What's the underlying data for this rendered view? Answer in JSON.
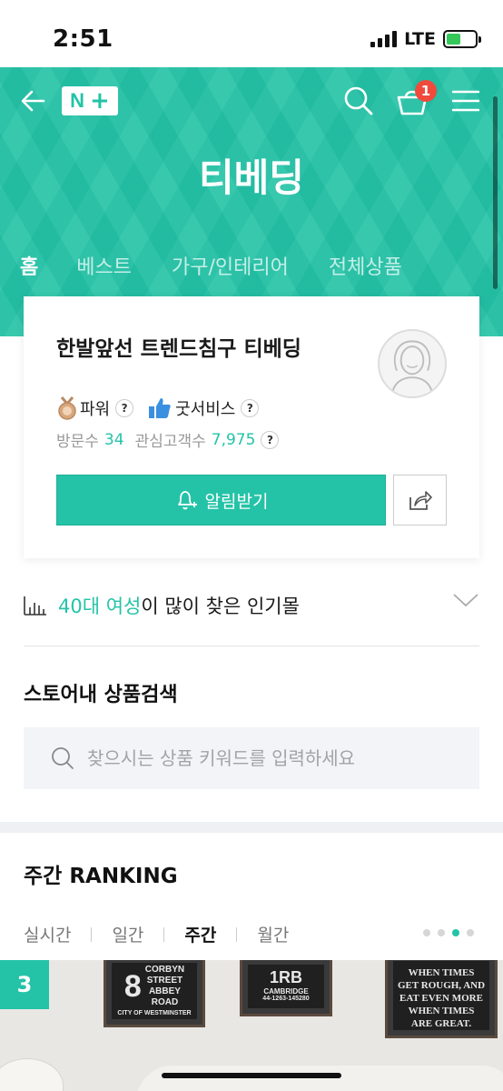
{
  "status_bar": {
    "time": "2:51",
    "network": "LTE"
  },
  "header": {
    "logo": {
      "n": "N",
      "plus": "+"
    },
    "cart_count": "1",
    "store_title": "티베딩",
    "tabs": [
      {
        "label": "홈",
        "active": true
      },
      {
        "label": "베스트",
        "active": false
      },
      {
        "label": "가구/인테리어",
        "active": false
      },
      {
        "label": "전체상품",
        "active": false
      }
    ],
    "accent_color": "#24c3a7"
  },
  "profile": {
    "name": "한발앞선 트렌드침구 티베딩",
    "grade_label": "파워",
    "service_label": "굿서비스",
    "help_mark": "?",
    "visits_label": "방문수",
    "visits_value": "34",
    "followers_label": "관심고객수",
    "followers_value": "7,975",
    "alarm_button": "알림받기"
  },
  "popular": {
    "highlight": "40대 여성",
    "rest": "이 많이 찾은 인기몰"
  },
  "store_search": {
    "title": "스토어내 상품검색",
    "placeholder": "찾으시는 상품 키워드를 입력하세요"
  },
  "ranking": {
    "title": "주간 RANKING",
    "tabs": [
      {
        "label": "실시간",
        "active": false
      },
      {
        "label": "일간",
        "active": false
      },
      {
        "label": "주간",
        "active": true
      },
      {
        "label": "월간",
        "active": false
      }
    ],
    "page_count": 4,
    "current_page": 3,
    "first_rank": "3",
    "frame_texts": {
      "left_lines": [
        "CORBYN",
        "STREET",
        "ABBEY",
        "ROAD",
        "CITY OF WESTMINSTER"
      ],
      "left_number": "8",
      "middle_lines": [
        "1RB",
        "CAMBRIDGE",
        "44-1263-145280"
      ],
      "right_lines": [
        "WHEN TIMES",
        "GET ROUGH, AND",
        "EAT EVEN MORE",
        "WHEN TIMES",
        "ARE GREAT."
      ]
    }
  }
}
